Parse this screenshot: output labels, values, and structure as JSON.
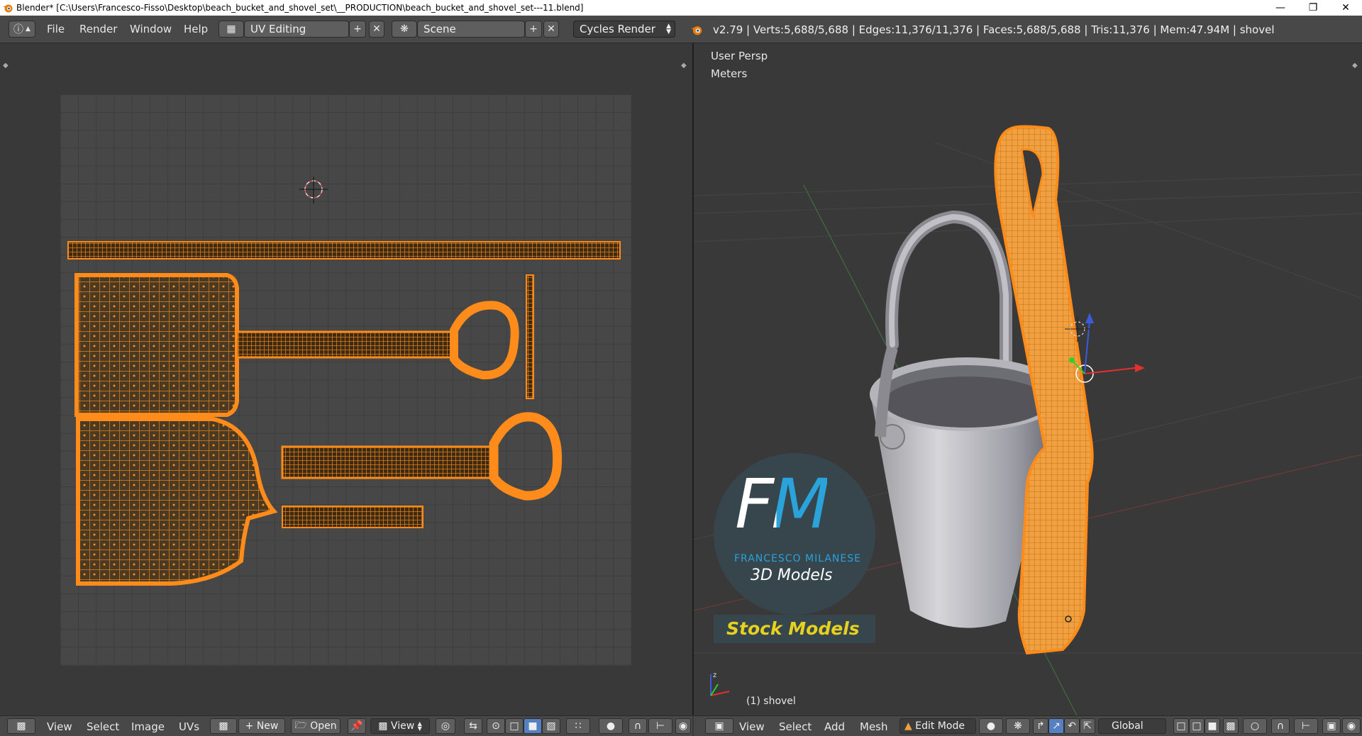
{
  "window": {
    "title": "Blender* [C:\\Users\\Francesco-Fisso\\Desktop\\beach_bucket_and_shovel_set\\__PRODUCTION\\beach_bucket_and_shovel_set---11.blend]"
  },
  "header": {
    "menus": [
      "File",
      "Render",
      "Window",
      "Help"
    ],
    "screen_layout": "UV Editing",
    "scene": "Scene",
    "render_engine": "Cycles Render",
    "stats": "v2.79 | Verts:5,688/5,688 | Edges:11,376/11,376 | Faces:5,688/5,688 | Tris:11,376 | Mem:47.94M | shovel"
  },
  "viewport": {
    "view_name": "User Persp",
    "units": "Meters",
    "object_label": "(1) shovel"
  },
  "watermark": {
    "initials": "FM",
    "name": "FRANCESCO MILANESE",
    "subtitle": "3D Models",
    "badge": "Stock Models"
  },
  "uv_footer": {
    "menus": [
      "View",
      "Select",
      "Image",
      "UVs"
    ],
    "new_label": "New",
    "open_label": "Open",
    "view_label": "View"
  },
  "view3d_footer": {
    "menus": [
      "View",
      "Select",
      "Add",
      "Mesh"
    ],
    "mode": "Edit Mode",
    "orientation": "Global"
  },
  "colors": {
    "accent_orange": "#ff8c1a",
    "background": "#393939",
    "header": "#484848",
    "watermark_blue": "#29a3d9",
    "badge_yellow": "#e6d21e"
  }
}
